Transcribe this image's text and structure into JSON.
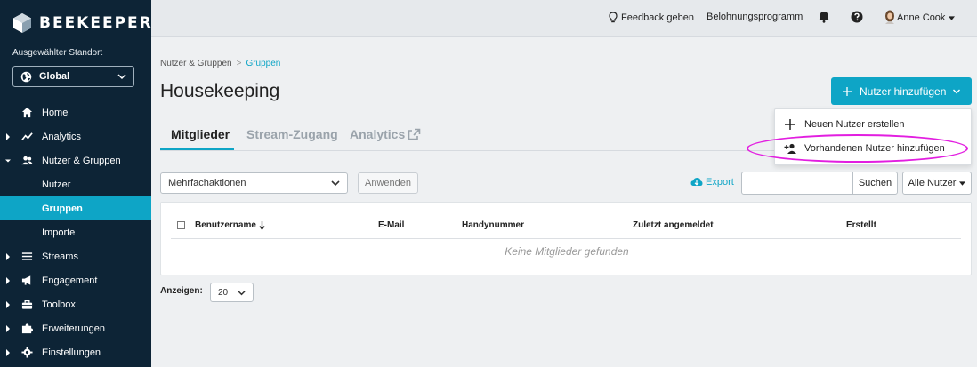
{
  "brand": {
    "name": "BEEKEEPER"
  },
  "sidebar": {
    "location_label": "Ausgewählter Standort",
    "location_value": "Global",
    "items": [
      {
        "label": "Home",
        "icon": "home-icon"
      },
      {
        "label": "Analytics",
        "icon": "analytics-icon"
      },
      {
        "label": "Nutzer & Gruppen",
        "icon": "users-icon"
      },
      {
        "label": "Nutzer"
      },
      {
        "label": "Gruppen"
      },
      {
        "label": "Importe"
      },
      {
        "label": "Streams",
        "icon": "list-icon"
      },
      {
        "label": "Engagement",
        "icon": "megaphone-icon"
      },
      {
        "label": "Toolbox",
        "icon": "toolbox-icon"
      },
      {
        "label": "Erweiterungen",
        "icon": "puzzle-icon"
      },
      {
        "label": "Einstellungen",
        "icon": "gear-icon"
      }
    ]
  },
  "topbar": {
    "feedback": "Feedback geben",
    "rewards": "Belohnungsprogramm",
    "user": "Anne Cook"
  },
  "breadcrumb": {
    "parent": "Nutzer & Gruppen",
    "current": "Gruppen"
  },
  "page": {
    "title": "Housekeeping"
  },
  "add_button": {
    "label": "Nutzer hinzufügen"
  },
  "add_menu": {
    "items": [
      {
        "label": "Neuen Nutzer erstellen"
      },
      {
        "label": "Vorhandenen Nutzer hinzufügen"
      }
    ]
  },
  "tabs": [
    {
      "label": "Mitglieder"
    },
    {
      "label": "Stream-Zugang"
    },
    {
      "label": "Analytics"
    }
  ],
  "toolbar": {
    "bulk_placeholder": "Mehrfachaktionen",
    "apply": "Anwenden",
    "export": "Export",
    "search_value": "",
    "search_button": "Suchen",
    "filter": "Alle Nutzer"
  },
  "table": {
    "columns": [
      "Benutzername",
      "E-Mail",
      "Handynummer",
      "Zuletzt angemeldet",
      "Erstellt"
    ],
    "empty": "Keine Mitglieder gefunden"
  },
  "pagination": {
    "label": "Anzeigen:",
    "value": "20"
  },
  "colors": {
    "accent": "#0ea5c6",
    "sidebar": "#0d2436",
    "highlight": "#e21ee0"
  }
}
